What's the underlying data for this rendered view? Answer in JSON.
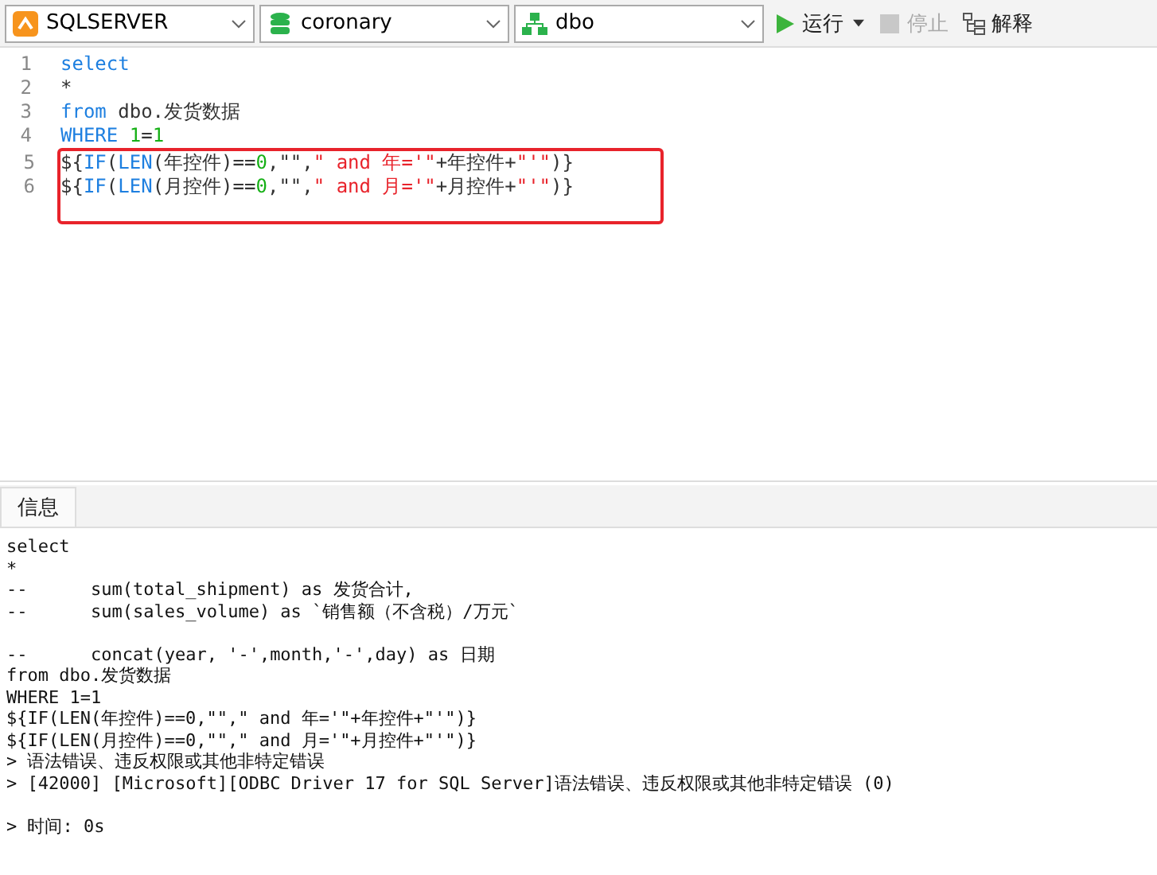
{
  "toolbar": {
    "selects": [
      {
        "kind": "connection",
        "value": "SQLSERVER"
      },
      {
        "kind": "database",
        "value": "coronary"
      },
      {
        "kind": "schema",
        "value": "dbo"
      }
    ],
    "buttons": [
      {
        "kind": "run",
        "label": "运行",
        "disabled": false,
        "dropdown": true
      },
      {
        "kind": "stop",
        "label": "停止",
        "disabled": true,
        "dropdown": false
      },
      {
        "kind": "explain",
        "label": "解释",
        "disabled": false,
        "dropdown": false
      }
    ]
  },
  "editor": {
    "blocks": [
      {
        "boxed": false,
        "lines": [
          {
            "number": "1",
            "tokens": [
              {
                "t": "select",
                "kind": "keyword"
              }
            ]
          },
          {
            "number": "2",
            "tokens": [
              {
                "t": "*",
                "kind": "plain"
              }
            ]
          },
          {
            "number": "3",
            "tokens": [
              {
                "t": "from",
                "kind": "keyword"
              },
              {
                "t": " dbo.发货数据",
                "kind": "plain"
              }
            ]
          },
          {
            "number": "4",
            "tokens": [
              {
                "t": "WHERE",
                "kind": "keyword"
              },
              {
                "t": " 1",
                "kind": "number"
              },
              {
                "t": "=",
                "kind": "plain"
              },
              {
                "t": "1",
                "kind": "number"
              }
            ]
          }
        ]
      },
      {
        "boxed": true,
        "lines": [
          {
            "number": "5",
            "tokens": [
              {
                "t": "${",
                "kind": "plain"
              },
              {
                "t": "IF",
                "kind": "keyword"
              },
              {
                "t": "(",
                "kind": "plain"
              },
              {
                "t": "LEN",
                "kind": "keyword"
              },
              {
                "t": "(年控件)==",
                "kind": "plain"
              },
              {
                "t": "0",
                "kind": "number"
              },
              {
                "t": ",\"\",",
                "kind": "plain"
              },
              {
                "t": "\" and 年='\"",
                "kind": "string"
              },
              {
                "t": "+年控件+",
                "kind": "plain"
              },
              {
                "t": "\"'\"",
                "kind": "string"
              },
              {
                "t": ")}",
                "kind": "plain"
              }
            ]
          },
          {
            "number": "6",
            "tokens": [
              {
                "t": "${",
                "kind": "plain"
              },
              {
                "t": "IF",
                "kind": "keyword"
              },
              {
                "t": "(",
                "kind": "plain"
              },
              {
                "t": "LEN",
                "kind": "keyword"
              },
              {
                "t": "(月控件)==",
                "kind": "plain"
              },
              {
                "t": "0",
                "kind": "number"
              },
              {
                "t": ",\"\",",
                "kind": "plain"
              },
              {
                "t": "\" and 月='\"",
                "kind": "string"
              },
              {
                "t": "+月控件+",
                "kind": "plain"
              },
              {
                "t": "\"'\"",
                "kind": "string"
              },
              {
                "t": ")}",
                "kind": "plain"
              }
            ]
          }
        ]
      }
    ]
  },
  "tabs": [
    {
      "label": "信息",
      "selected": true
    }
  ],
  "output": {
    "paragraphs": [
      [
        "select",
        "*",
        "--      sum(total_shipment) as 发货合计,",
        "--      sum(sales_volume) as `销售额（不含税）/万元`"
      ],
      [
        "--      concat(year, '-',month,'-',day) as 日期",
        "from dbo.发货数据",
        "WHERE 1=1",
        "${IF(LEN(年控件)==0,\"\",\" and 年='\"+年控件+\"'\")}",
        "${IF(LEN(月控件)==0,\"\",\" and 月='\"+月控件+\"'\")}",
        "> 语法错误、违反权限或其他非特定错误",
        "> [42000] [Microsoft][ODBC Driver 17 for SQL Server]语法错误、违反权限或其他非特定错误 (0)"
      ],
      [
        "> 时间: 0s"
      ]
    ]
  }
}
